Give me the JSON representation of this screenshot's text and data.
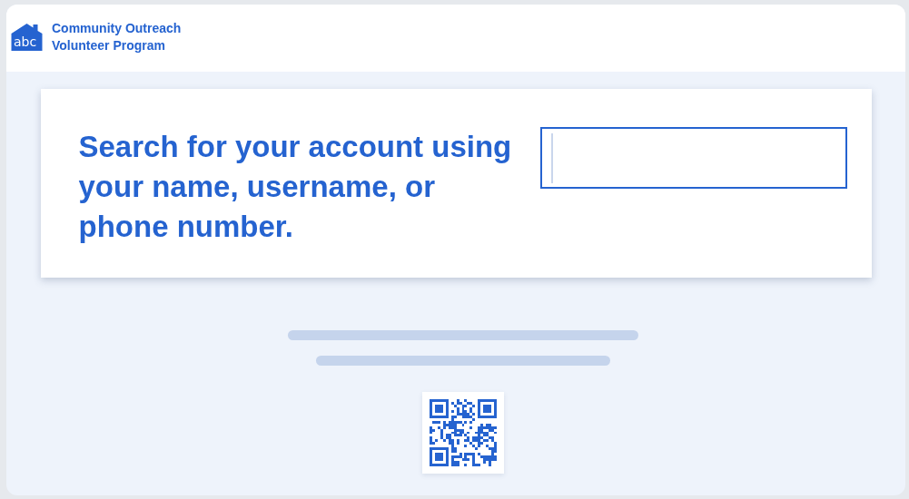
{
  "header": {
    "logo_text": "abc",
    "title_lines": [
      "Community Outreach",
      "Volunteer Program"
    ]
  },
  "prompt": {
    "text": "Search for your account using your name, username, or phone number."
  },
  "search": {
    "focused": true
  }
}
